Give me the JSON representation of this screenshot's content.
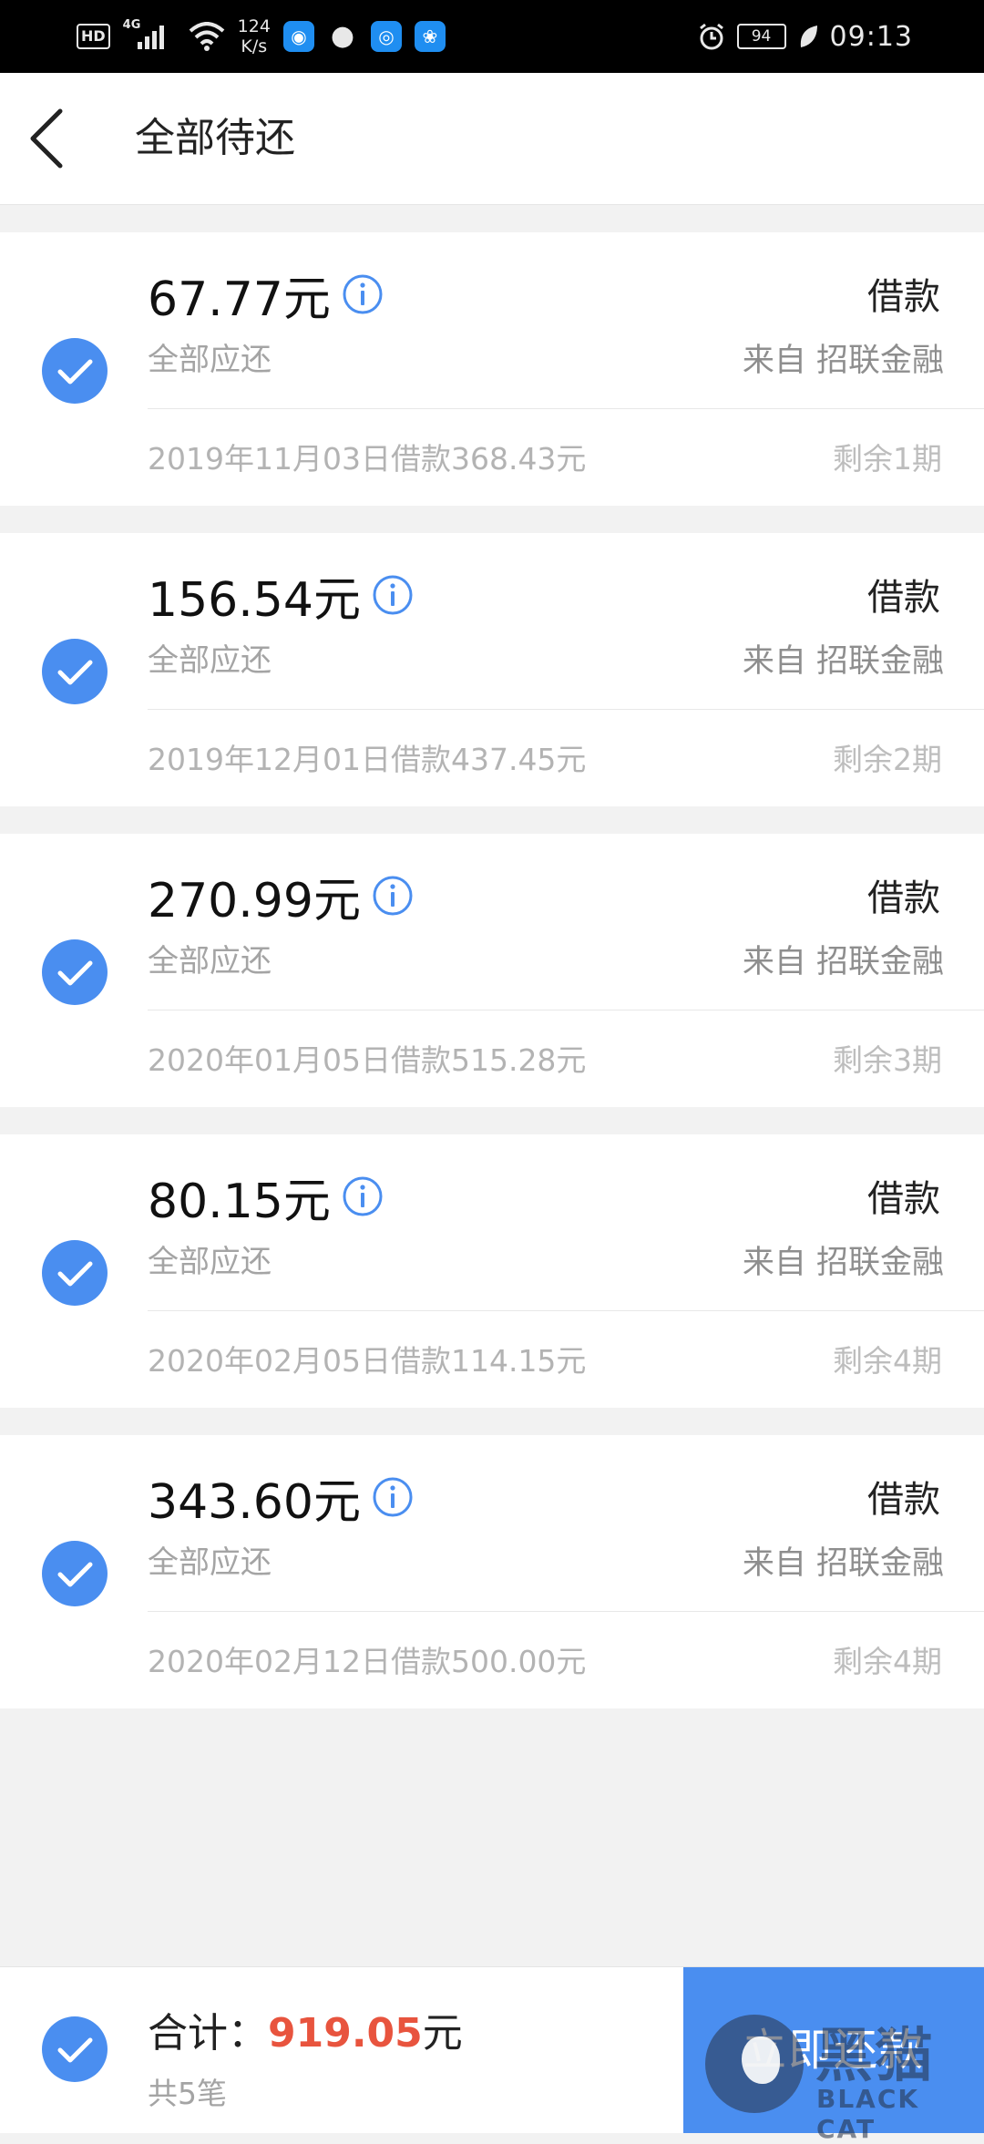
{
  "status_bar": {
    "hd": "HD",
    "network": "4G",
    "speed_value": "124",
    "speed_unit": "K/s",
    "battery": "94",
    "time": "09:13"
  },
  "header": {
    "title": "全部待还"
  },
  "loans": [
    {
      "amount": "67.77元",
      "sub_label": "全部应还",
      "type": "借款",
      "source": "来自 招联金融",
      "loan_info": "2019年11月03日借款368.43元",
      "remaining": "剩余1期"
    },
    {
      "amount": "156.54元",
      "sub_label": "全部应还",
      "type": "借款",
      "source": "来自 招联金融",
      "loan_info": "2019年12月01日借款437.45元",
      "remaining": "剩余2期"
    },
    {
      "amount": "270.99元",
      "sub_label": "全部应还",
      "type": "借款",
      "source": "来自 招联金融",
      "loan_info": "2020年01月05日借款515.28元",
      "remaining": "剩余3期"
    },
    {
      "amount": "80.15元",
      "sub_label": "全部应还",
      "type": "借款",
      "source": "来自 招联金融",
      "loan_info": "2020年02月05日借款114.15元",
      "remaining": "剩余4期"
    },
    {
      "amount": "343.60元",
      "sub_label": "全部应还",
      "type": "借款",
      "source": "来自 招联金融",
      "loan_info": "2020年02月12日借款500.00元",
      "remaining": "剩余4期"
    }
  ],
  "footer": {
    "total_label": "合计：",
    "total_value": "919.05",
    "total_unit": "元",
    "count": "共5笔",
    "pay_button": "立即还款"
  },
  "watermark": {
    "cn": "黑猫",
    "en": "BLACK CAT"
  },
  "colors": {
    "accent": "#4a8ef0",
    "total_red": "#e8543e"
  }
}
